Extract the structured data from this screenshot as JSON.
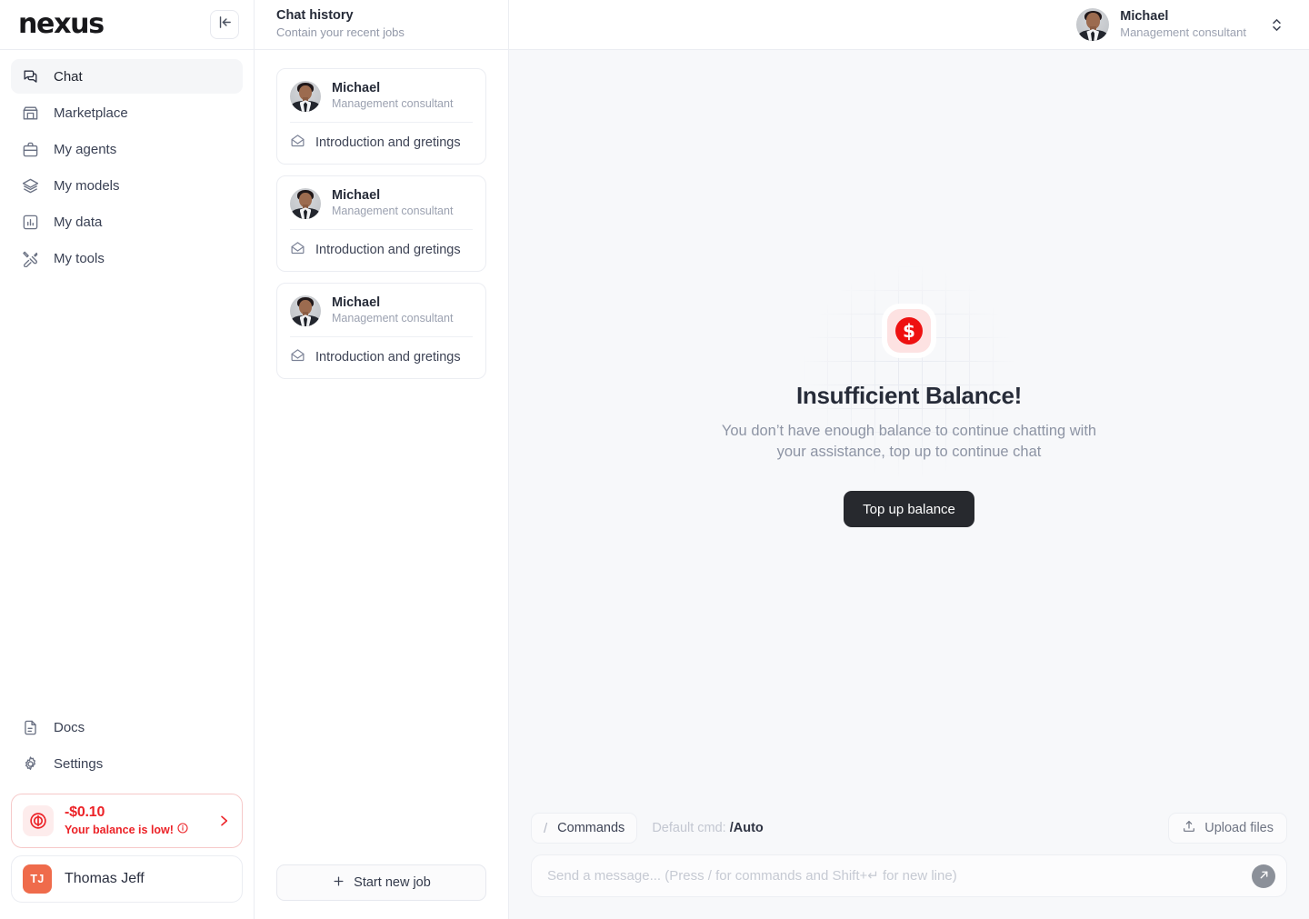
{
  "brand": {
    "logo_text": "nexus"
  },
  "sidebar": {
    "collapse_icon": "panel-collapse-left-icon",
    "nav": [
      {
        "label": "Chat",
        "icon": "chat-bubbles-icon",
        "active": true
      },
      {
        "label": "Marketplace",
        "icon": "storefront-icon",
        "active": false
      },
      {
        "label": "My agents",
        "icon": "briefcase-icon",
        "active": false
      },
      {
        "label": "My models",
        "icon": "layers-icon",
        "active": false
      },
      {
        "label": "My data",
        "icon": "bar-chart-icon",
        "active": false
      },
      {
        "label": "My tools",
        "icon": "tools-icon",
        "active": false
      }
    ],
    "nav_bottom": [
      {
        "label": "Docs",
        "icon": "document-icon"
      },
      {
        "label": "Settings",
        "icon": "gear-icon"
      }
    ],
    "balance": {
      "amount": "-$0.10",
      "note": "Your balance is low!",
      "icon": "dollar-coin-icon",
      "info_icon": "info-circle-icon",
      "chevron_icon": "chevron-right-icon",
      "accent_color": "#ec2227",
      "border_color": "#f6c9c9",
      "icon_bg": "#fdecec"
    },
    "user": {
      "initials": "TJ",
      "name": "Thomas Jeff",
      "avatar_color": "#ef6b4b"
    }
  },
  "history": {
    "title": "Chat history",
    "subtitle": "Contain your recent jobs",
    "jobs": [
      {
        "name": "Michael",
        "role": "Management consultant",
        "subject": "Introduction and gretings",
        "subject_icon": "open-envelope-icon",
        "avatar": "photo-michael"
      },
      {
        "name": "Michael",
        "role": "Management consultant",
        "subject": "Introduction and gretings",
        "subject_icon": "open-envelope-icon",
        "avatar": "photo-michael"
      },
      {
        "name": "Michael",
        "role": "Management consultant",
        "subject": "Introduction and gretings",
        "subject_icon": "open-envelope-icon",
        "avatar": "photo-michael"
      }
    ],
    "new_job_label": "Start new job",
    "new_job_icon": "plus-icon"
  },
  "header": {
    "agent": {
      "name": "Michael",
      "role": "Management consultant",
      "avatar": "photo-michael",
      "selector_icon": "chevron-up-down-icon"
    }
  },
  "empty_state": {
    "icon": "dollar-coin-icon",
    "coin_glyph": "$",
    "coin_color": "#ee1111",
    "coin_bg": "#fde2e2",
    "title": "Insufficient Balance!",
    "description": "You don’t have enough balance to continue chatting with your assistance, top up to continue chat",
    "cta_label": "Top up balance",
    "cta_color": "#27292e"
  },
  "composer": {
    "commands_label": "Commands",
    "commands_slash": "/",
    "default_cmd_label": "Default cmd:",
    "default_cmd_value": "/Auto",
    "upload_label": "Upload files",
    "upload_icon": "upload-icon",
    "input_value": "",
    "input_placeholder": "Send a message... (Press / for commands and Shift+↵ for new line)",
    "send_icon": "arrow-up-right-icon"
  }
}
